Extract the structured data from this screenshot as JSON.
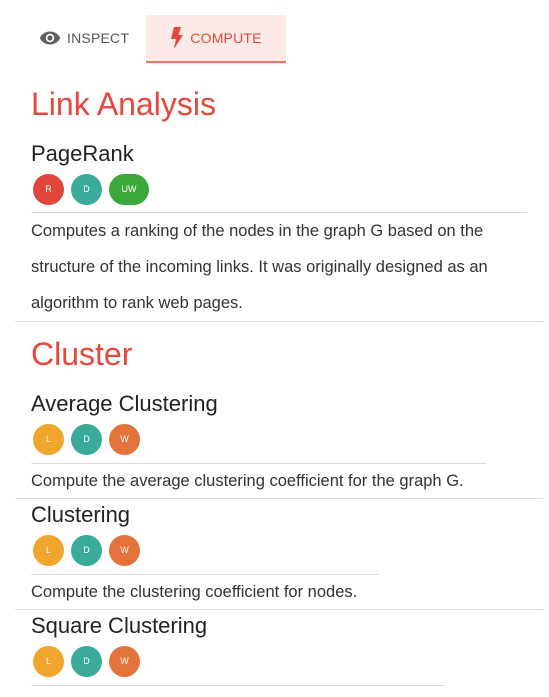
{
  "tabs": [
    {
      "label": "INSPECT",
      "icon": "eye-icon",
      "active": false
    },
    {
      "label": "COMPUTE",
      "icon": "bolt-icon",
      "active": true
    }
  ],
  "colors": {
    "accent": "#e8473d",
    "active_tab_bg": "#fde9e6",
    "badge_red": "#e0463c",
    "badge_teal": "#3aaa9a",
    "badge_green": "#3aa83a",
    "badge_yellow": "#f0a52c",
    "badge_orange": "#e3733a"
  },
  "sections": [
    {
      "title": "Link Analysis",
      "algorithms": [
        {
          "name": "PageRank",
          "badges": [
            "R",
            "D",
            "UW"
          ],
          "description": "Computes a ranking of the nodes in the graph G based on the structure of the incoming links. It was originally designed as an algorithm to rank web pages."
        }
      ]
    },
    {
      "title": "Cluster",
      "algorithms": [
        {
          "name": "Average Clustering",
          "badges": [
            "L",
            "D",
            "W"
          ],
          "description": "Compute the average clustering coefficient for the graph G."
        },
        {
          "name": "Clustering",
          "badges": [
            "L",
            "D",
            "W"
          ],
          "description": "Compute the clustering coefficient for nodes."
        },
        {
          "name": "Square Clustering",
          "badges": [
            "L",
            "D",
            "W"
          ]
        }
      ]
    }
  ]
}
